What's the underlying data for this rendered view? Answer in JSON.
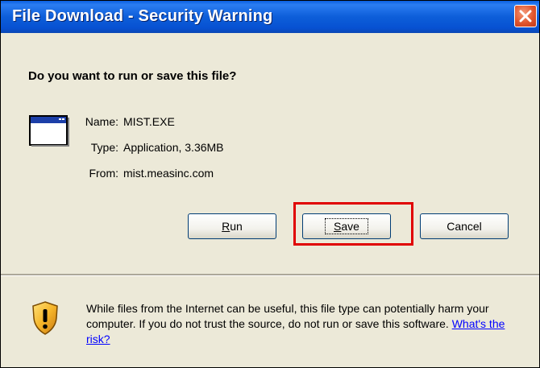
{
  "window": {
    "title": "File Download - Security Warning"
  },
  "dialog": {
    "question": "Do you want to run or save this file?",
    "fields": [
      {
        "label": "Name:",
        "value": "MIST.EXE"
      },
      {
        "label": "Type:",
        "value": "Application, 3.36MB"
      },
      {
        "label": "From:",
        "value": "mist.measinc.com"
      }
    ],
    "buttons": {
      "run_mnemonic": "R",
      "run_rest": "un",
      "save_mnemonic": "S",
      "save_rest": "ave",
      "cancel": "Cancel"
    }
  },
  "warning": {
    "text": "While files from the Internet can be useful, this file type can potentially harm your computer. If you do not trust the source, do not run or save this software.",
    "link": "What's the risk?"
  },
  "icons": {
    "close": "close-icon",
    "file": "application-window-icon",
    "shield": "security-shield-icon"
  },
  "colors": {
    "titlebar": "#0a5fe0",
    "dialog_bg": "#ece9d8",
    "highlight": "#e00000",
    "link": "#0000ff"
  }
}
